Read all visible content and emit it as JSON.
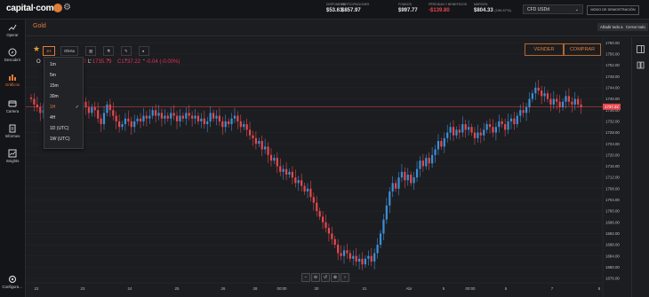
{
  "brand": {
    "name": "capital·com"
  },
  "stats": [
    {
      "label": "DISPONIBLE",
      "value": "$53.63"
    },
    {
      "label": "PARTICIPACIONES",
      "value": "$857.97"
    },
    {
      "label": "FONDOS",
      "value": "$997.77"
    },
    {
      "label": "PÉRDIDAS Y BENEFICIOS",
      "value": "-$139.80"
    },
    {
      "label": "MARGEN",
      "value": "$804.33",
      "pct": "(196.67%)"
    }
  ],
  "account": {
    "selected": "CFD USDd",
    "mode": "MODO DE DEMOSTRACIÓN"
  },
  "sidebar": [
    {
      "label": "Operar",
      "icon": "trend-icon"
    },
    {
      "label": "Descubrir",
      "icon": "compass-icon"
    },
    {
      "label": "Gráficos",
      "icon": "chart-icon"
    },
    {
      "label": "Cartera",
      "icon": "wallet-icon"
    },
    {
      "label": "Informes",
      "icon": "report-icon"
    },
    {
      "label": "Insights",
      "icon": "insights-icon"
    },
    {
      "label": "Configura…",
      "icon": "settings-icon"
    }
  ],
  "tab": {
    "label": "Gold"
  },
  "tab_actions": {
    "favorites": "Añadir todo a Favoritos",
    "close_all": "Cerrar todo"
  },
  "toolbar": {
    "timeframe": "1H",
    "price_type": "Oferta"
  },
  "ohlc": {
    "o_label": "O",
    "l_label": "L",
    "l_value": "1735.79",
    "c_value": "C1737.22",
    "h_partial": "00",
    "change": "-0.04 (-0.00%)"
  },
  "timeframes": [
    "1m",
    "5m",
    "15m",
    "30m",
    "1H",
    "4H",
    "1D (UTC)",
    "1W (UTC)"
  ],
  "timeframe_selected": "1H",
  "trade": {
    "sell": "VENDER",
    "buy": "COMPRAR"
  },
  "chart_data": {
    "type": "candlestick",
    "instrument": "Gold",
    "timeframe": "1H",
    "current_price": "1737.22",
    "y_ticks": [
      "1760.00",
      "1756.00",
      "1752.00",
      "1748.00",
      "1744.00",
      "1740.00",
      "1736.00",
      "1732.00",
      "1728.00",
      "1724.00",
      "1720.00",
      "1716.00",
      "1712.00",
      "1708.00",
      "1704.00",
      "1700.00",
      "1696.00",
      "1692.00",
      "1688.00",
      "1684.00",
      "1680.00",
      "1676.00"
    ],
    "ylim": [
      1676,
      1762
    ],
    "x_ticks": [
      "22",
      "23",
      "24",
      "25",
      "26",
      "28",
      "00:00",
      "30",
      "31",
      "Abr",
      "5",
      "00:00",
      "6",
      "7",
      "8"
    ],
    "candles_close_path": [
      1740,
      1738,
      1737,
      1735,
      1736,
      1734,
      1736,
      1738,
      1737,
      1739,
      1738,
      1735,
      1736,
      1737,
      1734,
      1732,
      1736,
      1739,
      1737,
      1735,
      1737,
      1736,
      1733,
      1731,
      1735,
      1738,
      1736,
      1734,
      1732,
      1730,
      1731,
      1733,
      1732,
      1730,
      1732,
      1733,
      1732,
      1734,
      1733,
      1734,
      1736,
      1734,
      1735,
      1733,
      1734,
      1733,
      1735,
      1734,
      1732,
      1734,
      1733,
      1735,
      1734,
      1733,
      1734,
      1732,
      1733,
      1731,
      1732,
      1735,
      1733,
      1734,
      1732,
      1730,
      1732,
      1731,
      1733,
      1734,
      1732,
      1730,
      1731,
      1729,
      1727,
      1726,
      1724,
      1725,
      1722,
      1723,
      1720,
      1718,
      1719,
      1716,
      1714,
      1715,
      1713,
      1714,
      1712,
      1710,
      1711,
      1709,
      1707,
      1708,
      1705,
      1703,
      1700,
      1698,
      1696,
      1694,
      1692,
      1690,
      1688,
      1685,
      1684,
      1686,
      1685,
      1683,
      1684,
      1682,
      1683,
      1681,
      1683,
      1684,
      1682,
      1685,
      1688,
      1692,
      1697,
      1702,
      1707,
      1710,
      1708,
      1712,
      1714,
      1711,
      1713,
      1710,
      1712,
      1715,
      1718,
      1716,
      1719,
      1717,
      1720,
      1722,
      1725,
      1723,
      1726,
      1728,
      1730,
      1727,
      1729,
      1728,
      1731,
      1729,
      1730,
      1728,
      1726,
      1728,
      1727,
      1729,
      1731,
      1730,
      1728,
      1730,
      1732,
      1731,
      1729,
      1732,
      1733,
      1731,
      1734,
      1736,
      1735,
      1737,
      1740,
      1742,
      1744,
      1743,
      1741,
      1742,
      1740,
      1738,
      1740,
      1739,
      1737,
      1739,
      1741,
      1739,
      1738,
      1740,
      1738,
      1737
    ]
  }
}
